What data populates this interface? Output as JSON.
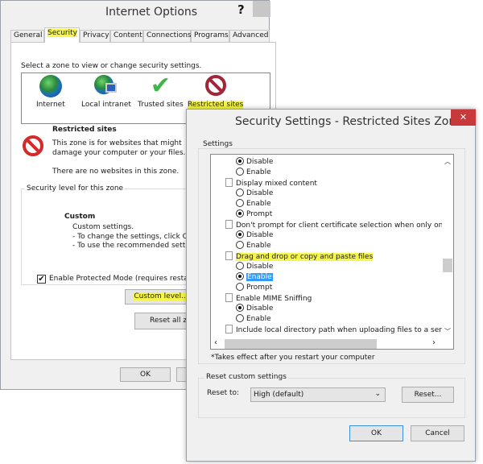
{
  "internet_options": {
    "title": "Internet Options",
    "help": "?",
    "tabs": [
      "General",
      "Security",
      "Privacy",
      "Content",
      "Connections",
      "Programs",
      "Advanced"
    ],
    "active_tab": "Security",
    "zone_prompt": "Select a zone to view or change security settings.",
    "zones": [
      {
        "label": "Internet",
        "icon": "globe-icon"
      },
      {
        "label": "Local intranet",
        "icon": "intranet-icon"
      },
      {
        "label": "Trusted sites",
        "icon": "checkmark-icon"
      },
      {
        "label": "Restricted sites",
        "icon": "no-entry-icon"
      }
    ],
    "selected_zone": "Restricted sites",
    "zone_title": "Restricted sites",
    "zone_desc1": "This zone is for websites that might",
    "zone_desc2": "damage your computer or your files.",
    "zone_desc3": "There are no websites in this zone.",
    "level_group": "Security level for this zone",
    "level_name": "Custom",
    "level_line1": "Custom settings.",
    "level_line2": "- To change the settings, click Custom level.",
    "level_line3": "- To use the recommended settings, click Default level.",
    "protected_mode": "Enable Protected Mode (requires restarting Internet Explorer)",
    "protected_mode_checked": true,
    "custom_level": "Custom level...",
    "reset_all": "Reset all zones to default level",
    "ok": "OK"
  },
  "security_settings": {
    "title": "Security Settings - Restricted Sites Zone",
    "close": "✕",
    "settings_label": "Settings",
    "items": [
      {
        "type": "radio",
        "label": "Disable",
        "checked": true
      },
      {
        "type": "radio",
        "label": "Enable",
        "checked": false
      },
      {
        "type": "header",
        "label": "Display mixed content"
      },
      {
        "type": "radio",
        "label": "Disable",
        "checked": false
      },
      {
        "type": "radio",
        "label": "Enable",
        "checked": false
      },
      {
        "type": "radio",
        "label": "Prompt",
        "checked": true
      },
      {
        "type": "header",
        "label": "Don't prompt for client certificate selection when only one ce"
      },
      {
        "type": "radio",
        "label": "Disable",
        "checked": true
      },
      {
        "type": "radio",
        "label": "Enable",
        "checked": false
      },
      {
        "type": "header",
        "label": "Drag and drop or copy and paste files",
        "highlight": true
      },
      {
        "type": "radio",
        "label": "Disable",
        "checked": false
      },
      {
        "type": "radio",
        "label": "Enable",
        "checked": true,
        "selected": true
      },
      {
        "type": "radio",
        "label": "Prompt",
        "checked": false
      },
      {
        "type": "header",
        "label": "Enable MIME Sniffing"
      },
      {
        "type": "radio",
        "label": "Disable",
        "checked": true
      },
      {
        "type": "radio",
        "label": "Enable",
        "checked": false
      },
      {
        "type": "header",
        "label": "Include local directory path when uploading files to a server"
      }
    ],
    "note": "*Takes effect after you restart your computer",
    "reset_group": "Reset custom settings",
    "reset_to_label": "Reset to:",
    "reset_to_value": "High (default)",
    "reset_button": "Reset...",
    "ok": "OK",
    "cancel": "Cancel",
    "highlight_color": "#f6f64a",
    "selection_color": "#3399ff",
    "close_color": "#c7393a"
  }
}
